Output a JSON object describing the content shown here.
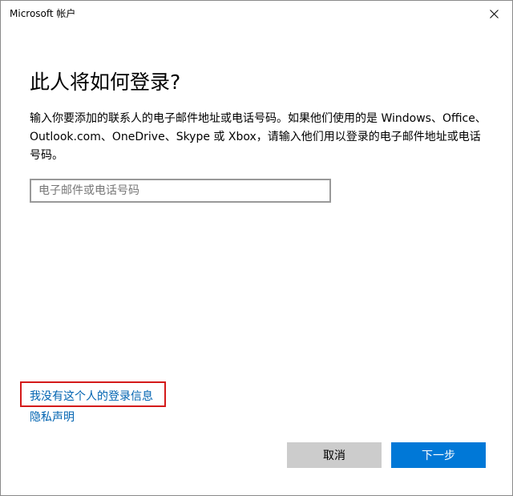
{
  "window": {
    "title": "Microsoft 帐户"
  },
  "main": {
    "heading": "此人将如何登录?",
    "description": "输入你要添加的联系人的电子邮件地址或电话号码。如果他们使用的是 Windows、Office、Outlook.com、OneDrive、Skype 或 Xbox，请输入他们用以登录的电子邮件地址或电话号码。",
    "email_placeholder": "电子邮件或电话号码",
    "email_value": ""
  },
  "links": {
    "no_info": "我没有这个人的登录信息",
    "privacy": "隐私声明"
  },
  "buttons": {
    "cancel": "取消",
    "next": "下一步"
  },
  "icons": {
    "close": "close-icon"
  },
  "colors": {
    "link": "#0063b1",
    "primary_button": "#0078d7",
    "secondary_button": "#cccccc",
    "highlight_box": "#d41a1a"
  }
}
